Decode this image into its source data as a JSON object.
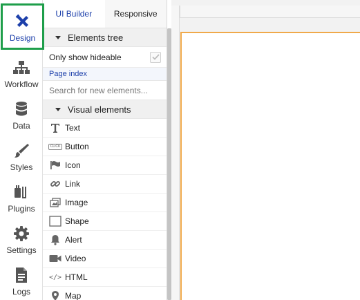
{
  "rail": {
    "items": [
      {
        "label": "Design",
        "icon": "design-icon"
      },
      {
        "label": "Workflow",
        "icon": "workflow-icon"
      },
      {
        "label": "Data",
        "icon": "database-icon"
      },
      {
        "label": "Styles",
        "icon": "brush-icon"
      },
      {
        "label": "Plugins",
        "icon": "plug-icon"
      },
      {
        "label": "Settings",
        "icon": "gear-icon"
      },
      {
        "label": "Logs",
        "icon": "document-icon"
      }
    ]
  },
  "panel": {
    "tabs": [
      {
        "label": "UI Builder"
      },
      {
        "label": "Responsive"
      }
    ],
    "elements_tree_label": "Elements tree",
    "only_show_hideable_label": "Only show hideable",
    "page_index_label": "Page index",
    "search_placeholder": "Search for new elements...",
    "visual_elements_label": "Visual elements",
    "elements": [
      {
        "label": "Text",
        "icon": "text-icon"
      },
      {
        "label": "Button",
        "icon": "button-icon",
        "icon_text": "CLICK"
      },
      {
        "label": "Icon",
        "icon": "flag-icon"
      },
      {
        "label": "Link",
        "icon": "link-icon"
      },
      {
        "label": "Image",
        "icon": "image-icon"
      },
      {
        "label": "Shape",
        "icon": "shape-icon"
      },
      {
        "label": "Alert",
        "icon": "bell-icon"
      },
      {
        "label": "Video",
        "icon": "video-icon"
      },
      {
        "label": "HTML",
        "icon": "html-icon",
        "icon_text": "</>"
      },
      {
        "label": "Map",
        "icon": "map-pin-icon"
      }
    ]
  },
  "colors": {
    "accent": "#1c3faa",
    "active_border": "#1e9e4a",
    "canvas_border": "#f0a94a"
  }
}
